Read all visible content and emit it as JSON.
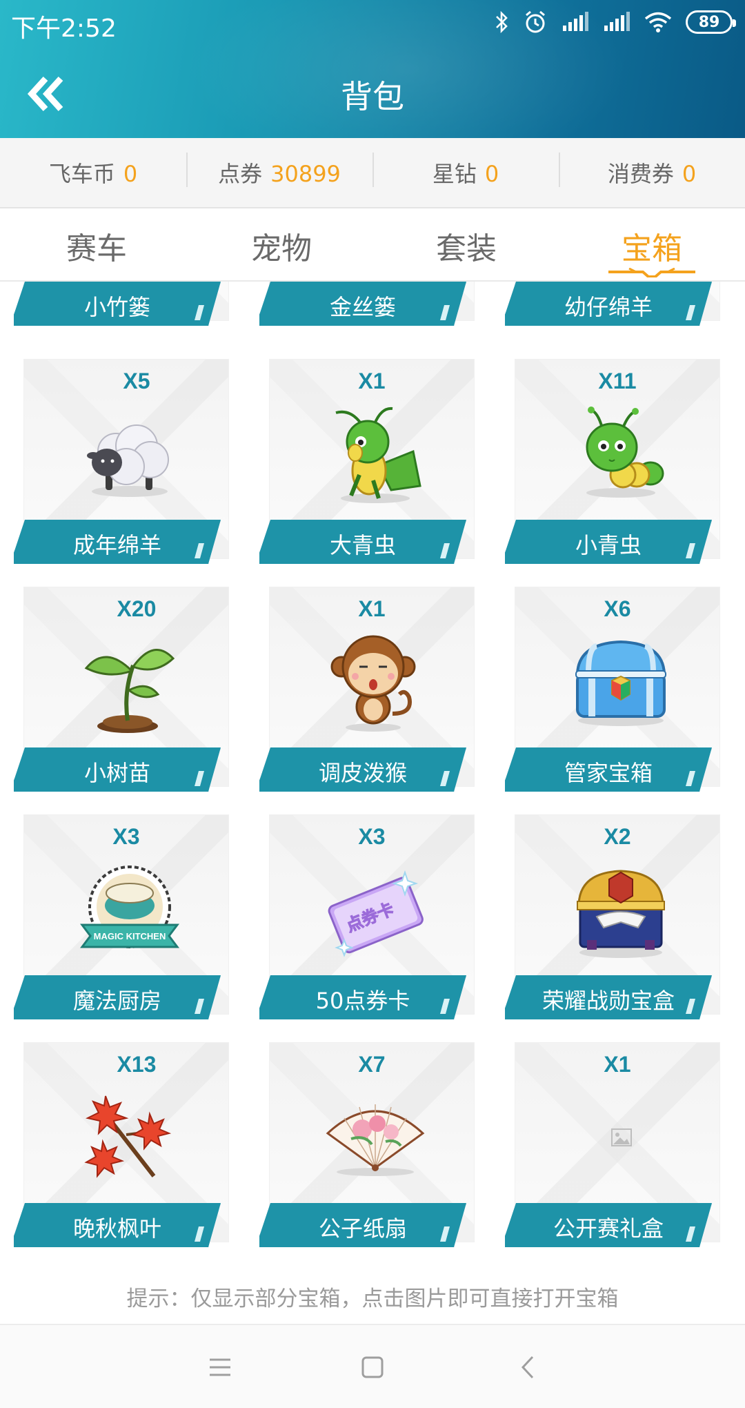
{
  "status_bar": {
    "time": "下午2:52",
    "battery": "89"
  },
  "header": {
    "title": "背包"
  },
  "currencies": [
    {
      "label": "飞车币",
      "value": "0"
    },
    {
      "label": "点券",
      "value": "30899"
    },
    {
      "label": "星钻",
      "value": "0"
    },
    {
      "label": "消费券",
      "value": "0"
    }
  ],
  "tabs": [
    {
      "label": "赛车"
    },
    {
      "label": "宠物"
    },
    {
      "label": "套装"
    },
    {
      "label": "宝箱"
    }
  ],
  "active_tab": "宝箱",
  "items": [
    {
      "name": "小竹篓",
      "count": "",
      "icon": "bamboo-basket-icon"
    },
    {
      "name": "金丝篓",
      "count": "",
      "icon": "gold-basket-icon"
    },
    {
      "name": "幼仔绵羊",
      "count": "",
      "icon": "lamb-icon"
    },
    {
      "name": "成年绵羊",
      "count": "X5",
      "icon": "sheep-icon"
    },
    {
      "name": "大青虫",
      "count": "X1",
      "icon": "grasshopper-icon"
    },
    {
      "name": "小青虫",
      "count": "X11",
      "icon": "caterpillar-icon"
    },
    {
      "name": "小树苗",
      "count": "X20",
      "icon": "sapling-icon"
    },
    {
      "name": "调皮泼猴",
      "count": "X1",
      "icon": "monkey-icon"
    },
    {
      "name": "管家宝箱",
      "count": "X6",
      "icon": "crystal-chest-icon"
    },
    {
      "name": "魔法厨房",
      "count": "X3",
      "icon": "magic-kitchen-icon"
    },
    {
      "name": "50点券卡",
      "count": "X3",
      "icon": "coupon-card-icon"
    },
    {
      "name": "荣耀战勋宝盒",
      "count": "X2",
      "icon": "glory-chest-icon"
    },
    {
      "name": "晚秋枫叶",
      "count": "X13",
      "icon": "maple-leaf-icon"
    },
    {
      "name": "公子纸扇",
      "count": "X7",
      "icon": "paper-fan-icon"
    },
    {
      "name": "公开赛礼盒",
      "count": "X1",
      "icon": "image-placeholder-icon"
    }
  ],
  "magic_kitchen_banner": "MAGIC KITCHEN",
  "coupon_card_text": "点券卡",
  "hint": "提示：仅显示部分宝箱，点击图片即可直接打开宝箱",
  "colors": {
    "accent": "#f4a21d",
    "band": "#1e93a8",
    "count": "#1a8aa3"
  }
}
